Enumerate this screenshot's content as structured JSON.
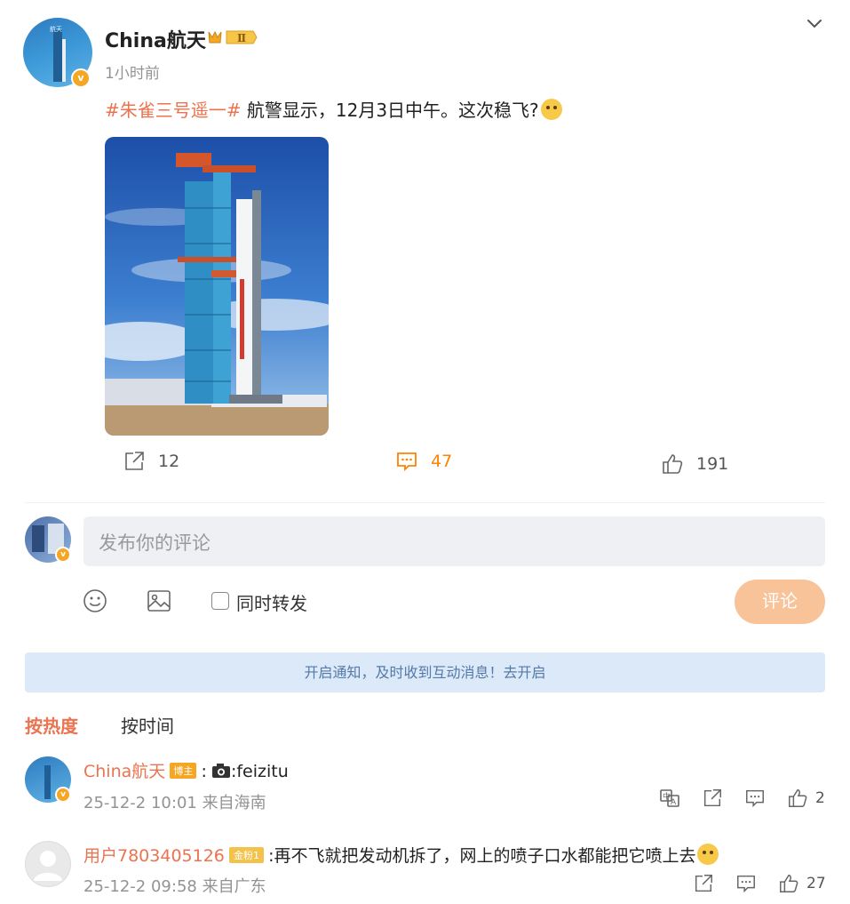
{
  "post": {
    "author": "China航天",
    "time": "1小时前",
    "hashtag": "#朱雀三号遥一#",
    "text": " 航警显示，12月3日中午。这次稳飞?",
    "level_badge": "Ⅱ",
    "verified_mark": "v"
  },
  "actions": {
    "repost_count": "12",
    "comment_count": "47",
    "like_count": "191"
  },
  "composer": {
    "placeholder": "发布你的评论",
    "repost_label": "同时转发",
    "submit_label": "评论"
  },
  "notice": "开启通知，及时收到互动消息！去开启",
  "sort": {
    "hot": "按热度",
    "time": "按时间"
  },
  "comments": [
    {
      "user": "China航天",
      "tag": "博主",
      "text": ":",
      "text_suffix": ":feizitu",
      "meta": "25-12-2 10:01 来自海南",
      "likes": "2"
    },
    {
      "user": "用户7803405126",
      "tag": "金粉1",
      "text": ":再不飞就把发动机拆了，网上的喷子口水都能把它喷上去",
      "meta": "25-12-2 09:58 来自广东",
      "likes": "27"
    }
  ],
  "colors": {
    "accent_orange": "#ff8200",
    "hashtag": "#eb7350",
    "submit_disabled": "#f8c398",
    "notice_bg": "#dce9f8"
  }
}
